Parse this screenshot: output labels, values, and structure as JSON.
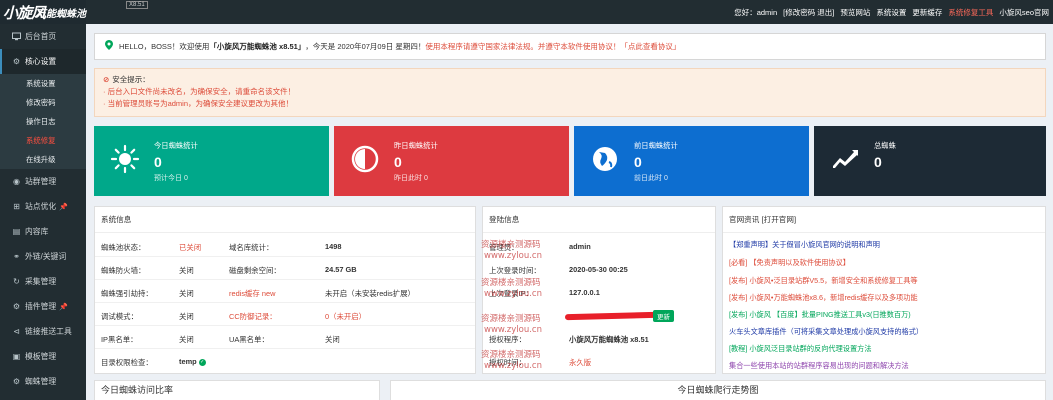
{
  "logo": {
    "main": "小旋风",
    "sub": "万能蜘蛛池",
    "version": "X8.51"
  },
  "topnav": {
    "greeting": "您好：admin",
    "user_links": "[修改密码 退出]",
    "preview": "预览网站",
    "settings": "系统设置",
    "update_cache": "更新缓存",
    "repair_tool": "系统修复工具",
    "official": "小旋风seo官网"
  },
  "sidebar": {
    "home": "后台首页",
    "core": "核心设置",
    "core_sub": [
      "系统设置",
      "修改密码",
      "操作日志",
      "系统修复",
      "在线升级"
    ],
    "items": [
      "站群管理",
      "站点优化",
      "内容库",
      "外链/关键词",
      "采集管理",
      "插件管理",
      "链接推送工具",
      "模板管理",
      "蜘蛛管理"
    ]
  },
  "notice": {
    "hello": "HELLO，BOSS！欢迎使用",
    "product": "「小旋风万能蜘蛛池 x8.51」",
    "today": "，今天是 2020年07月09日 星期四！",
    "warning": "使用本程序请遵守国家法律法规。并遵守本软件使用协议！",
    "agreement": "「点此查看协议」"
  },
  "security": {
    "title": "安全提示：",
    "lines": [
      "· 后台入口文件尚未改名，为确保安全，请重命名该文件！",
      "· 当前管理员账号为admin，为确保安全建议更改为其他！"
    ]
  },
  "stats": [
    {
      "label": "今日蜘蛛统计",
      "value": "0",
      "foot": "预计今日 0",
      "color": "#00a88a"
    },
    {
      "label": "昨日蜘蛛统计",
      "value": "0",
      "foot": "昨日此时 0",
      "color": "#dd3a40"
    },
    {
      "label": "前日蜘蛛统计",
      "value": "0",
      "foot": "前日此时 0",
      "color": "#0d6ed0"
    },
    {
      "label": "总蜘蛛",
      "value": "0",
      "foot": "",
      "color": "#1d2a35"
    }
  ],
  "sysinfo": {
    "title": "系统信息",
    "rows": [
      {
        "k1": "蜘蛛池状态：",
        "v1": "已关闭",
        "k2": "域名库统计：",
        "v2": "1498"
      },
      {
        "k1": "蜘蛛防火墙：",
        "v1": "关闭",
        "k2": "磁盘剩余空间：",
        "v2": "24.57 GB"
      },
      {
        "k1": "蜘蛛强引劫持：",
        "v1": "关闭",
        "k2": "redis缓存 new",
        "v2": "未开启（未安装redis扩展）"
      },
      {
        "k1": "调试模式：",
        "v1": "关闭",
        "k2": "CC防御记录：",
        "v2": "0（未开启）"
      },
      {
        "k1": "IP黑名单：",
        "v1": "关闭",
        "k2": "UA黑名单：",
        "v2": "关闭"
      },
      {
        "k1": "目录权限检查：",
        "v1": "temp",
        "k2": "",
        "v2": ""
      }
    ]
  },
  "login": {
    "title": "登陆信息",
    "rows": [
      {
        "k": "管理员：",
        "v": "admin"
      },
      {
        "k": "上次登录时间：",
        "v": "2020-05-30 00:25"
      },
      {
        "k": "上次登录IP：",
        "v": "127.0.0.1"
      },
      {
        "k": "",
        "v": ""
      },
      {
        "k": "授权程序：",
        "v": "小旋风万能蜘蛛池 x8.51"
      },
      {
        "k": "授权时间：",
        "v": "永久版"
      }
    ],
    "update_label": "更新"
  },
  "news": {
    "title": "官网资讯 [打开官网]",
    "items": [
      {
        "text": "【郑重声明】关于假冒小旋风官网的说明和声明",
        "color": "blue"
      },
      {
        "text": "[必看] 【免责声明以及软件使用协议】",
        "color": "red"
      },
      {
        "text": "[发布] 小旋风•泛目录站群V5.5，新增安全和系统修复工具等",
        "color": "red"
      },
      {
        "text": "[发布] 小旋风•万能蜘蛛池x8.6，新增redis缓存以及多项功能",
        "color": "red"
      },
      {
        "text": "[发布] 小旋风 【百度】批量PING推送工具v3(日推数百万)",
        "color": "green"
      },
      {
        "text": "火车头文章库插件（可将采集文章处理成小旋风支持的格式）",
        "color": "blue"
      },
      {
        "text": "[教程] 小旋风泛目录站群的反向代理设置方法",
        "color": "green"
      },
      {
        "text": "集合一些使用本站的站群程序容易出现的问题和解决方法",
        "color": "purple"
      }
    ]
  },
  "watermark": {
    "line1": "资源楼亲测源码",
    "line2": "www.zylou.cn"
  },
  "bottom": {
    "left": "今日蜘蛛访问比率",
    "right": "今日蜘蛛爬行走势图"
  }
}
